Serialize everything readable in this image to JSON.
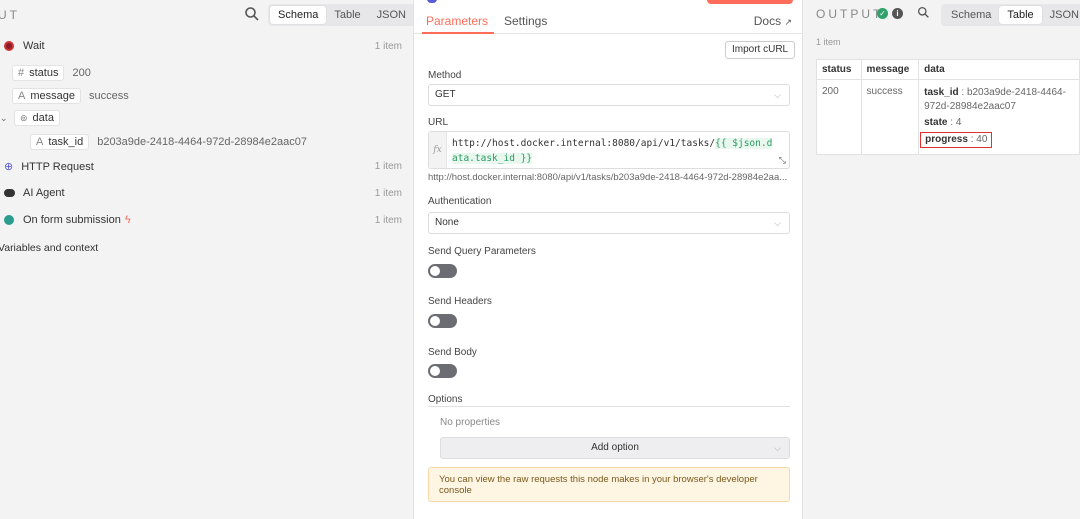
{
  "left": {
    "title": "UT",
    "view_tabs": [
      "Schema",
      "Table",
      "JSON"
    ],
    "active_view": "Schema",
    "nodes": [
      {
        "name": "Wait",
        "count": "1 item"
      },
      {
        "name": "HTTP Request",
        "count": "1 item"
      },
      {
        "name": "AI Agent",
        "count": "1 item"
      },
      {
        "name": "On form submission",
        "count": "1 item"
      }
    ],
    "fields": {
      "status": {
        "type": "#",
        "key": "status",
        "value": "200"
      },
      "message": {
        "type": "A",
        "key": "message",
        "value": "success"
      },
      "data": {
        "key": "data"
      },
      "task_id": {
        "type": "A",
        "key": "task_id",
        "value": "b203a9de-2418-4464-972d-28984e2aac07"
      }
    },
    "variables_label": "Variables and context"
  },
  "middle": {
    "tabs": [
      "Parameters",
      "Settings"
    ],
    "docs_label": "Docs",
    "import_label": "Import cURL",
    "method_label": "Method",
    "method_value": "GET",
    "url_label": "URL",
    "url_prefix": "http://host.docker.internal:8080/api/v1/tasks/",
    "url_expression": "{{ $json.data.task_id }}",
    "url_resolved": "http://host.docker.internal:8080/api/v1/tasks/b203a9de-2418-4464-972d-28984e2aa...",
    "auth_label": "Authentication",
    "auth_value": "None",
    "send_query_label": "Send Query Parameters",
    "send_headers_label": "Send Headers",
    "send_body_label": "Send Body",
    "options_label": "Options",
    "no_properties": "No properties",
    "add_option_label": "Add option",
    "notice_text": "You can view the raw requests this node makes in your browser's developer console"
  },
  "right": {
    "title": "OUTPUT",
    "view_tabs": [
      "Schema",
      "Table",
      "JSON"
    ],
    "active_view": "Table",
    "items_count": "1 item",
    "columns": [
      "status",
      "message",
      "data"
    ],
    "row": {
      "status": "200",
      "message": "success",
      "task_id_key": "task_id",
      "task_id_value": "b203a9de-2418-4464-972d-28984e2aac07",
      "state_key": "state",
      "state_value": "4",
      "progress_key": "progress",
      "progress_value": "40"
    }
  },
  "colors": {
    "accent": "#ff6d5a",
    "success": "#2ea26a",
    "highlight": "#e03232"
  }
}
